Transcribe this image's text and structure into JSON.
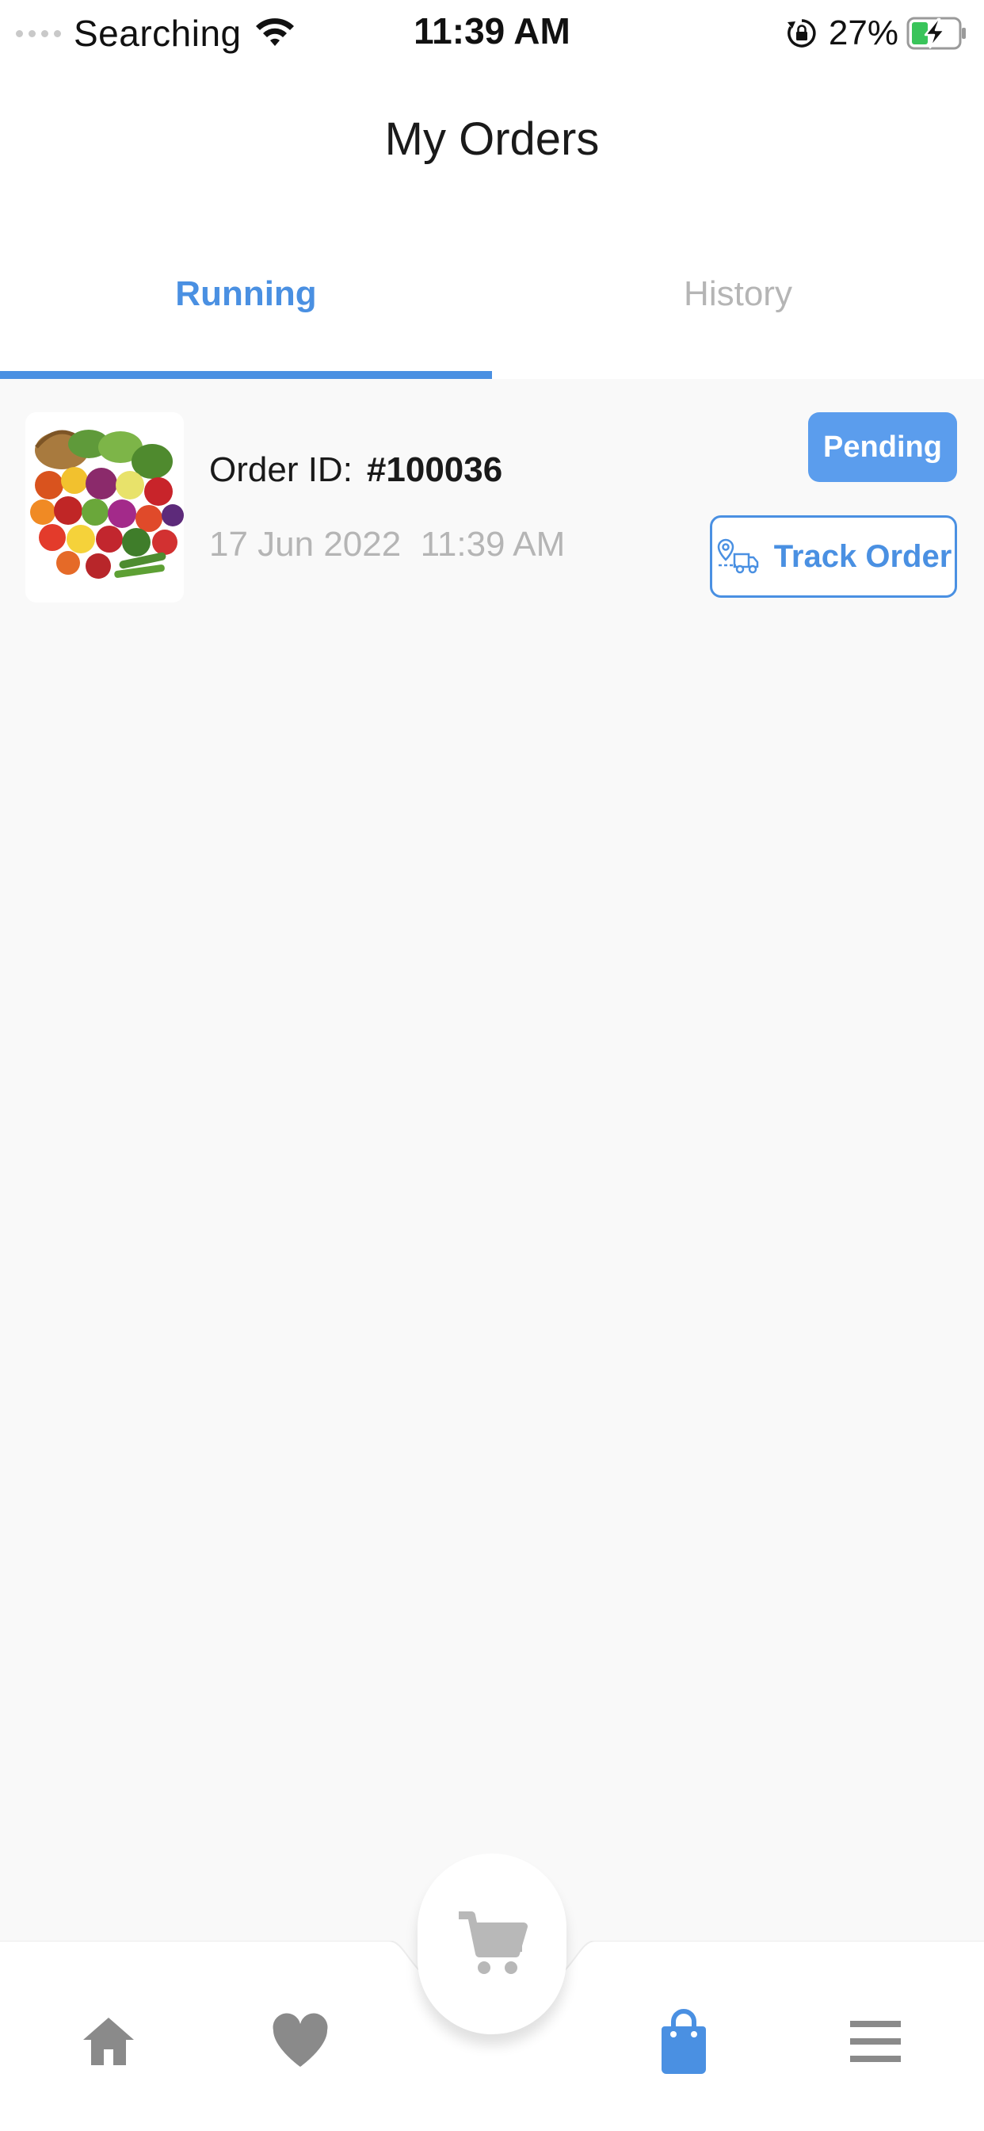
{
  "status_bar": {
    "carrier": "Searching",
    "time": "11:39 AM",
    "battery_percent": "27%",
    "icons": [
      "signal-dots-icon",
      "wifi-icon",
      "rotation-lock-icon",
      "battery-charging-icon"
    ]
  },
  "header": {
    "title": "My Orders"
  },
  "tabs": [
    {
      "label": "Running",
      "active": true
    },
    {
      "label": "History",
      "active": false
    }
  ],
  "orders": [
    {
      "id_label": "Order ID:",
      "id_value": "#100036",
      "date": "17 Jun 2022  11:39 AM",
      "status": "Pending",
      "track_label": "Track Order",
      "image": "vegetables-fruits-image"
    }
  ],
  "bottom_nav": {
    "items": [
      {
        "icon": "home-icon",
        "active": false
      },
      {
        "icon": "heart-icon",
        "active": false
      },
      {
        "icon": "cart-icon",
        "active": false
      },
      {
        "icon": "shopping-bag-icon",
        "active": true
      },
      {
        "icon": "menu-icon",
        "active": false
      }
    ]
  },
  "colors": {
    "accent": "#4a90e2",
    "badge": "#5b9ded",
    "inactive_text": "#b5b5b5",
    "inactive_icon": "#8a8a8a"
  }
}
